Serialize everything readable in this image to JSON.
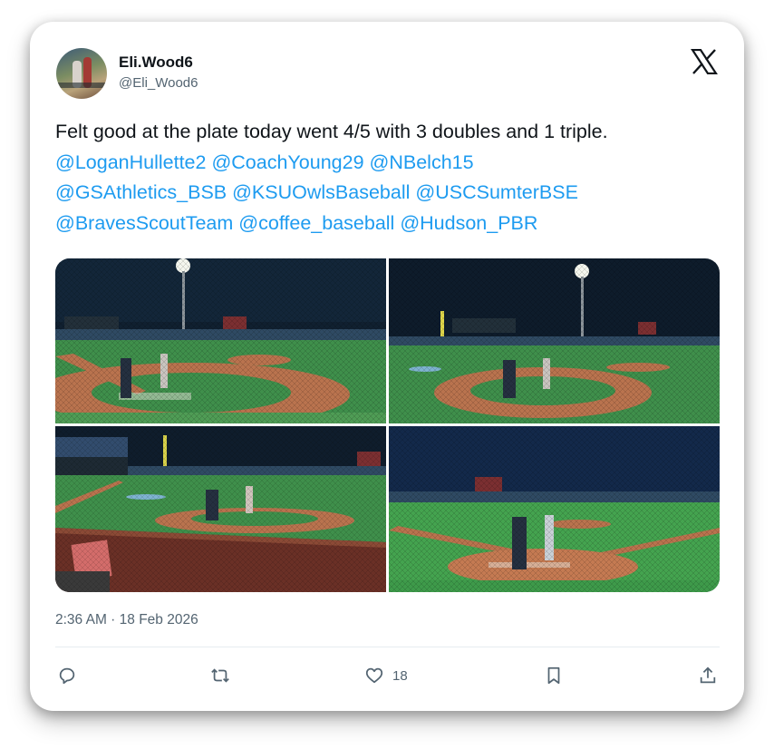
{
  "author": {
    "display_name": "Eli.Wood6",
    "handle": "@Eli_Wood6"
  },
  "tweet": {
    "text_line1": "Felt good at the plate today went 4/5 with 3 doubles and 1 triple.",
    "mention_lines": [
      [
        "@LoganHullette2",
        "@CoachYoung29",
        "@NBelch15"
      ],
      [
        "@GSAthletics_BSB",
        "@KSUOwlsBaseball",
        "@USCSumterBSE"
      ],
      [
        "@BravesScoutTeam",
        "@coffee_baseball",
        "@Hudson_PBR"
      ]
    ],
    "mention_color": "#1d9bf0",
    "timestamp": "2:36 AM · 18 Feb 2026"
  },
  "media": [
    {
      "name": "photo-batter-behind-plate-1",
      "description_icon": "baseball-night-game-photo"
    },
    {
      "name": "photo-batter-behind-plate-2",
      "description_icon": "baseball-night-game-photo"
    },
    {
      "name": "photo-batter-dugout-view",
      "description_icon": "baseball-night-game-photo"
    },
    {
      "name": "photo-batter-closeup",
      "description_icon": "baseball-night-game-photo"
    }
  ],
  "actions": {
    "reply_icon": "reply-icon",
    "retweet_icon": "retweet-icon",
    "like_icon": "heart-icon",
    "like_count": "18",
    "bookmark_icon": "bookmark-icon",
    "share_icon": "share-icon"
  },
  "brand": {
    "logo_icon": "x-logo-icon"
  }
}
